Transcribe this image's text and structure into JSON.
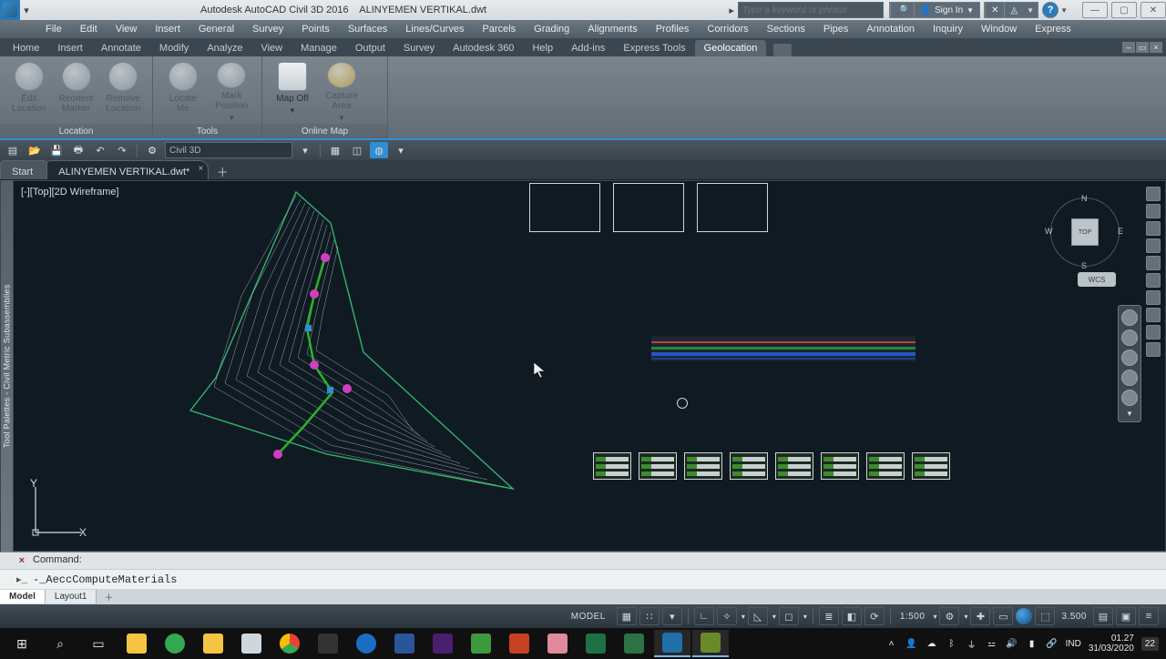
{
  "title_bar": {
    "app_name": "Autodesk AutoCAD Civil 3D 2016",
    "file_name": "ALINYEMEN VERTIKAL.dwt",
    "search_placeholder": "Type a keyword or phrase",
    "sign_in": "Sign In"
  },
  "menu": [
    "File",
    "Edit",
    "View",
    "Insert",
    "General",
    "Survey",
    "Points",
    "Surfaces",
    "Lines/Curves",
    "Parcels",
    "Grading",
    "Alignments",
    "Profiles",
    "Corridors",
    "Sections",
    "Pipes",
    "Annotation",
    "Inquiry",
    "Window",
    "Express"
  ],
  "ribbon_tabs": [
    "Home",
    "Insert",
    "Annotate",
    "Modify",
    "Analyze",
    "View",
    "Manage",
    "Output",
    "Survey",
    "Autodesk 360",
    "Help",
    "Add-ins",
    "Express Tools",
    "Geolocation"
  ],
  "ribbon_active": "Geolocation",
  "ribbon_groups": {
    "location": {
      "label": "Location",
      "buttons": [
        {
          "label1": "Edit",
          "label2": "Location"
        },
        {
          "label1": "Reorient",
          "label2": "Marker"
        },
        {
          "label1": "Remove",
          "label2": "Location"
        }
      ]
    },
    "tools": {
      "label": "Tools",
      "buttons": [
        {
          "label1": "Locate",
          "label2": "Me"
        },
        {
          "label1": "Mark",
          "label2": "Position"
        }
      ]
    },
    "onlinemap": {
      "label": "Online Map",
      "buttons": [
        {
          "label1": "Map Off",
          "label2": ""
        },
        {
          "label1": "Capture",
          "label2": "Area"
        }
      ]
    }
  },
  "workspace_selector": "Civil 3D",
  "file_tabs": {
    "start": "Start",
    "file": "ALINYEMEN VERTIKAL.dwt*"
  },
  "left_palette": "Tool Palettes - Civil Metric Subassemblies",
  "view_label": "[-][Top][2D Wireframe]",
  "ucs": {
    "x": "X",
    "y": "Y"
  },
  "viewcube": {
    "n": "N",
    "e": "E",
    "s": "S",
    "w": "W",
    "face": "TOP",
    "wcs": "WCS"
  },
  "command": {
    "history": "Command:",
    "value": "-_AeccComputeMaterials"
  },
  "layout_tabs": {
    "model": "Model",
    "layout1": "Layout1"
  },
  "status": {
    "model": "MODEL",
    "scale": "1:500",
    "decimal": "3.500"
  },
  "tray": {
    "ime": "IND",
    "time": "01.27",
    "date": "31/03/2020",
    "notif": "22"
  }
}
